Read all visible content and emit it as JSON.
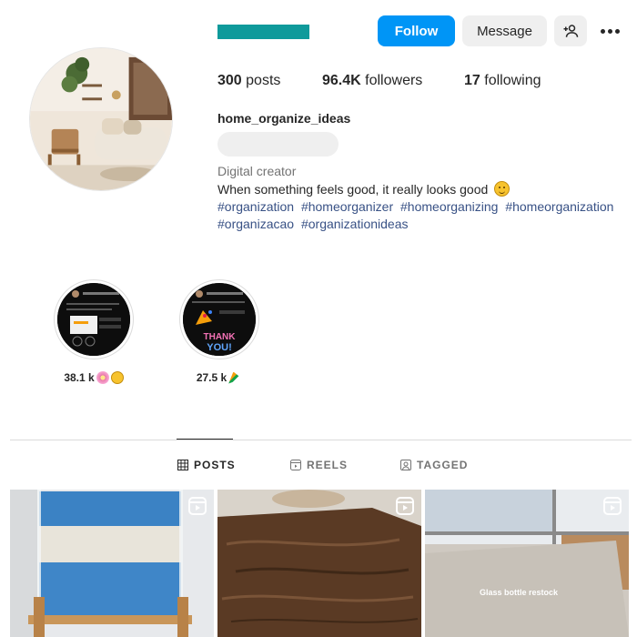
{
  "header": {
    "follow_label": "Follow",
    "message_label": "Message",
    "adduser_icon": "person-add-icon",
    "more_icon": "more-horizontal-icon",
    "username_bar_color": "#0f9a9b"
  },
  "stats": {
    "posts_count": "300",
    "posts_label": "posts",
    "followers_count": "96.4K",
    "followers_label": "followers",
    "following_count": "17",
    "following_label": "following"
  },
  "profile": {
    "name": "home_organize_ideas",
    "category": "Digital creator",
    "bio": "When something feels good, it really looks good",
    "hashtags": [
      "#organization",
      "#homeorganizer",
      "#homeorganizing",
      "#homeorganization",
      "#organizacao",
      "#organizationideas"
    ]
  },
  "highlights": [
    {
      "label": "38.1 k"
    },
    {
      "label": "27.5 k"
    }
  ],
  "tabs": [
    {
      "label": "POSTS",
      "icon": "grid-icon",
      "active": true
    },
    {
      "label": "REELS",
      "icon": "reels-icon",
      "active": false
    },
    {
      "label": "TAGGED",
      "icon": "tagged-icon",
      "active": false
    }
  ],
  "posts": [
    {
      "type": "reel",
      "caption": ""
    },
    {
      "type": "reel",
      "caption": ""
    },
    {
      "type": "reel",
      "caption": "Glass bottle restock"
    }
  ],
  "colors": {
    "accent": "#0095f6",
    "hashtag": "#385185",
    "secondary_text": "#737373"
  }
}
